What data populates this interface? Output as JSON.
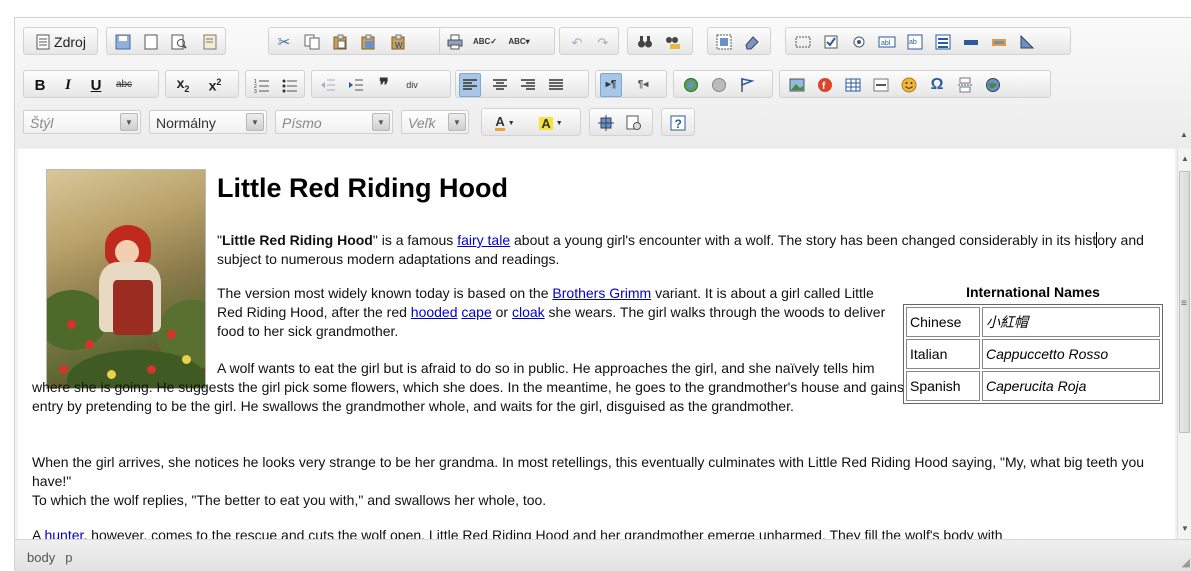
{
  "toolbar": {
    "source_label": "Zdroj",
    "style_combo": "Štýl",
    "format_combo": "Normálny",
    "font_combo": "Písmo",
    "size_combo": "Veľk"
  },
  "article": {
    "title": "Little Red Riding Hood",
    "p1": {
      "quote_open": "\"",
      "bold": "Little Red Riding Hood",
      "t1": "\" is a famous ",
      "link1": "fairy tale",
      "t2": " about a young girl's encounter with a wolf. The story has been changed considerably in its hist",
      "t3": "ory and subject to numerous modern adaptations and readings."
    },
    "p2": {
      "t1": "The version most widely known today is based on the ",
      "link1": "Brothers Grimm",
      "t2": " variant. It is about a girl called Little Red Riding Hood, after the red ",
      "link2": "hooded",
      "t3": " ",
      "link3": "cape",
      "t4": " or ",
      "link4": "cloak",
      "t5": " she wears. The girl walks through the woods to deliver food to her sick grandmother."
    },
    "p3": "A wolf wants to eat the girl but is afraid to do so in public. He approaches the girl, and she naïvely tells him where she is going. He suggests the girl pick some flowers, which she does. In the meantime, he goes to the grandmother's house and gains entry by pretending to be the girl. He swallows the grandmother whole, and waits for the girl, disguised as the grandmother.",
    "p4a": "When the girl arrives, she notices he looks very strange to be her grandma. In most retellings, this eventually culminates with Little Red Riding Hood saying, \"My, what big teeth you have!\"",
    "p4b": "To which the wolf replies, \"The better to eat you with,\" and swallows her whole, too.",
    "p5": {
      "t1": "A ",
      "link1": "hunter",
      "t2": ", however, comes to the rescue and cuts the wolf open. Little Red Riding Hood and her grandmother emerge unharmed. They fill the wolf's body with"
    },
    "table": {
      "caption": "International Names",
      "rows": [
        {
          "lang": "Chinese",
          "name": "小紅帽"
        },
        {
          "lang": "Italian",
          "name": "Cappuccetto Rosso"
        },
        {
          "lang": "Spanish",
          "name": "Caperucita Roja"
        }
      ]
    }
  },
  "statusbar": {
    "path": [
      "body",
      "p"
    ]
  },
  "colors": {
    "link": "#0000cc",
    "active_button": "#a8c7e8"
  }
}
